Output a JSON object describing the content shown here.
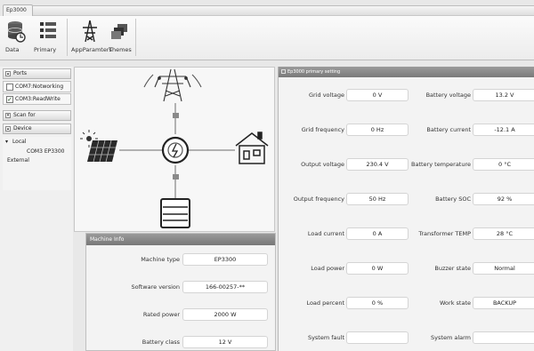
{
  "app": {
    "title": "Ep3000"
  },
  "ribbon": {
    "data_label": "Data",
    "primary_label": "Primary",
    "appparams_label": "AppParamters",
    "themes_label": "Themes"
  },
  "nav": {
    "ports_label": "Ports",
    "ports": [
      {
        "label": "COM7:Notworking",
        "checked": false
      },
      {
        "label": "COM3:ReadWrite",
        "checked": true
      }
    ],
    "scan_label": "Scan for",
    "device_label": "Device",
    "tree_local": "Local",
    "tree_device": "COM3 EP3300",
    "tree_external": "External"
  },
  "machine_info": {
    "title": "Machine Info",
    "rows": [
      {
        "label": "Machine type",
        "value": "EP3300"
      },
      {
        "label": "Software version",
        "value": "166-00257-**"
      },
      {
        "label": "Rated power",
        "value": "2000 W"
      },
      {
        "label": "Battery class",
        "value": "12 V"
      }
    ]
  },
  "primary": {
    "title": "Ep3000 primary setting",
    "left": [
      {
        "label": "Grid voltage",
        "value": "0 V"
      },
      {
        "label": "Grid frequency",
        "value": "0 Hz"
      },
      {
        "label": "Output voltage",
        "value": "230.4 V"
      },
      {
        "label": "Output frequency",
        "value": "50 Hz"
      },
      {
        "label": "Load current",
        "value": "0 A"
      },
      {
        "label": "Load power",
        "value": "0 W"
      },
      {
        "label": "Load percent",
        "value": "0 %"
      },
      {
        "label": "System fault",
        "value": ""
      }
    ],
    "right": [
      {
        "label": "Battery voltage",
        "value": "13.2 V"
      },
      {
        "label": "Battery current",
        "value": "-12.1 A"
      },
      {
        "label": "Battery temperature",
        "value": "0 °C"
      },
      {
        "label": "Battery SOC",
        "value": "92 %"
      },
      {
        "label": "Transformer TEMP",
        "value": "28 °C"
      },
      {
        "label": "Buzzer state",
        "value": "Normal"
      },
      {
        "label": "Work state",
        "value": "BACKUP"
      },
      {
        "label": "System alarm",
        "value": ""
      }
    ]
  },
  "colors": {
    "header_gray": "#8a8a8a",
    "link_gray": "#9a9a9a",
    "pole_gray": "#555555"
  }
}
